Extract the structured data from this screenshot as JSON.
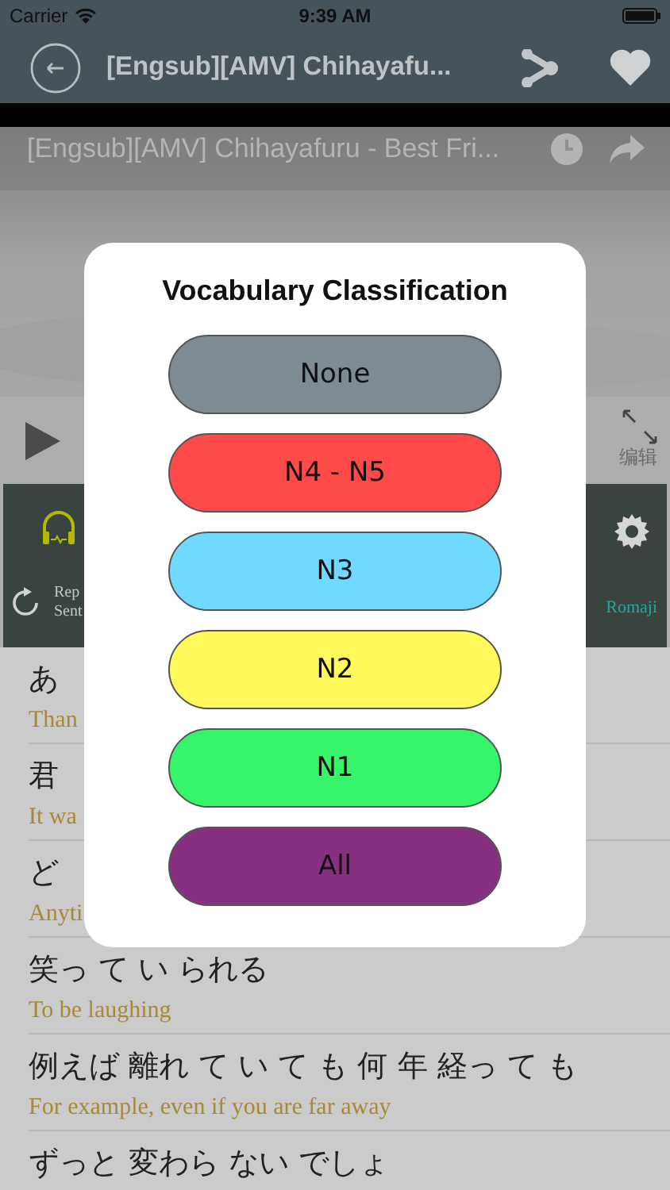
{
  "status_bar": {
    "carrier": "Carrier",
    "time": "9:39 AM"
  },
  "nav_bar": {
    "title": "[Engsub][AMV] Chihayafu..."
  },
  "video": {
    "kind": "picture",
    "title": "[Engsub][AMV] Chihayafuru - Best Fri..."
  },
  "player": {
    "side_text": "编辑"
  },
  "toolbar": {
    "left_label": "Rep Sent",
    "right_label": "Romaji"
  },
  "lyrics": [
    {
      "japanese": "あ",
      "english": "Than"
    },
    {
      "japanese": "君",
      "english": "It wa"
    },
    {
      "japanese": "ど",
      "english": "Anyti"
    },
    {
      "japanese": "笑っ て い られる",
      "english": "To be laughing"
    },
    {
      "japanese": "例えば 離れ て い て も 何 年 経っ て も",
      "english": "For example, even if you are far away"
    },
    {
      "japanese": "ずっと 変わら ない でしょ"
    }
  ],
  "dialog": {
    "title": "Vocabulary Classification",
    "options": [
      {
        "label": "None",
        "color": "#7e8b92"
      },
      {
        "label": "N4 - N5",
        "color": "#ff4a4a"
      },
      {
        "label": "N3",
        "color": "#6fd9ff"
      },
      {
        "label": "N2",
        "color": "#fff95c"
      },
      {
        "label": "N1",
        "color": "#36f56a"
      },
      {
        "label": "All",
        "color": "#86307f"
      }
    ]
  }
}
